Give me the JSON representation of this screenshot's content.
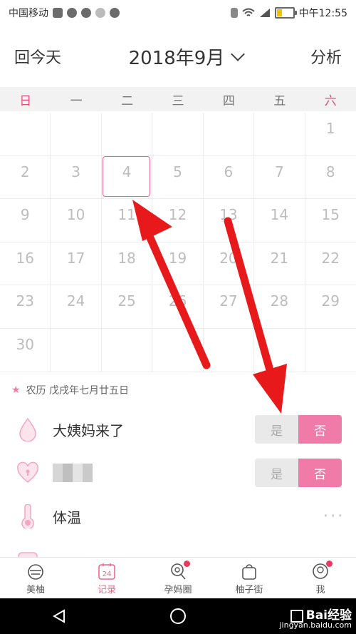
{
  "status_bar": {
    "carrier": "中国移动",
    "time": "中午12:55"
  },
  "header": {
    "today_label": "回今天",
    "month_label": "2018年9月",
    "analysis_label": "分析"
  },
  "weekdays": [
    "日",
    "一",
    "二",
    "三",
    "四",
    "五",
    "六"
  ],
  "calendar": {
    "days": [
      "",
      "",
      "",
      "",
      "",
      "",
      "1",
      "2",
      "3",
      "4",
      "5",
      "6",
      "7",
      "8",
      "9",
      "10",
      "11",
      "12",
      "13",
      "14",
      "15",
      "16",
      "17",
      "18",
      "19",
      "20",
      "21",
      "22",
      "23",
      "24",
      "25",
      "26",
      "27",
      "28",
      "29",
      "30",
      "",
      "",
      "",
      "",
      "",
      ""
    ],
    "selected_day": "4"
  },
  "lunar_date": "农历 戊戌年七月廿五日",
  "records": {
    "period_label": "大姨妈来了",
    "yes_label": "是",
    "no_label": "否",
    "temperature_label": "体温",
    "more_label": "···"
  },
  "tabs": [
    "美柚",
    "记录",
    "孕妈圈",
    "柚子街",
    "我"
  ],
  "record_tab_day": "24",
  "watermark": {
    "brand": "Bai经验",
    "url": "jingyan.baidu.com"
  },
  "colors": {
    "accent": "#e86a88",
    "toggle_on": "#f07aa8",
    "arrow": "#e8191b"
  }
}
